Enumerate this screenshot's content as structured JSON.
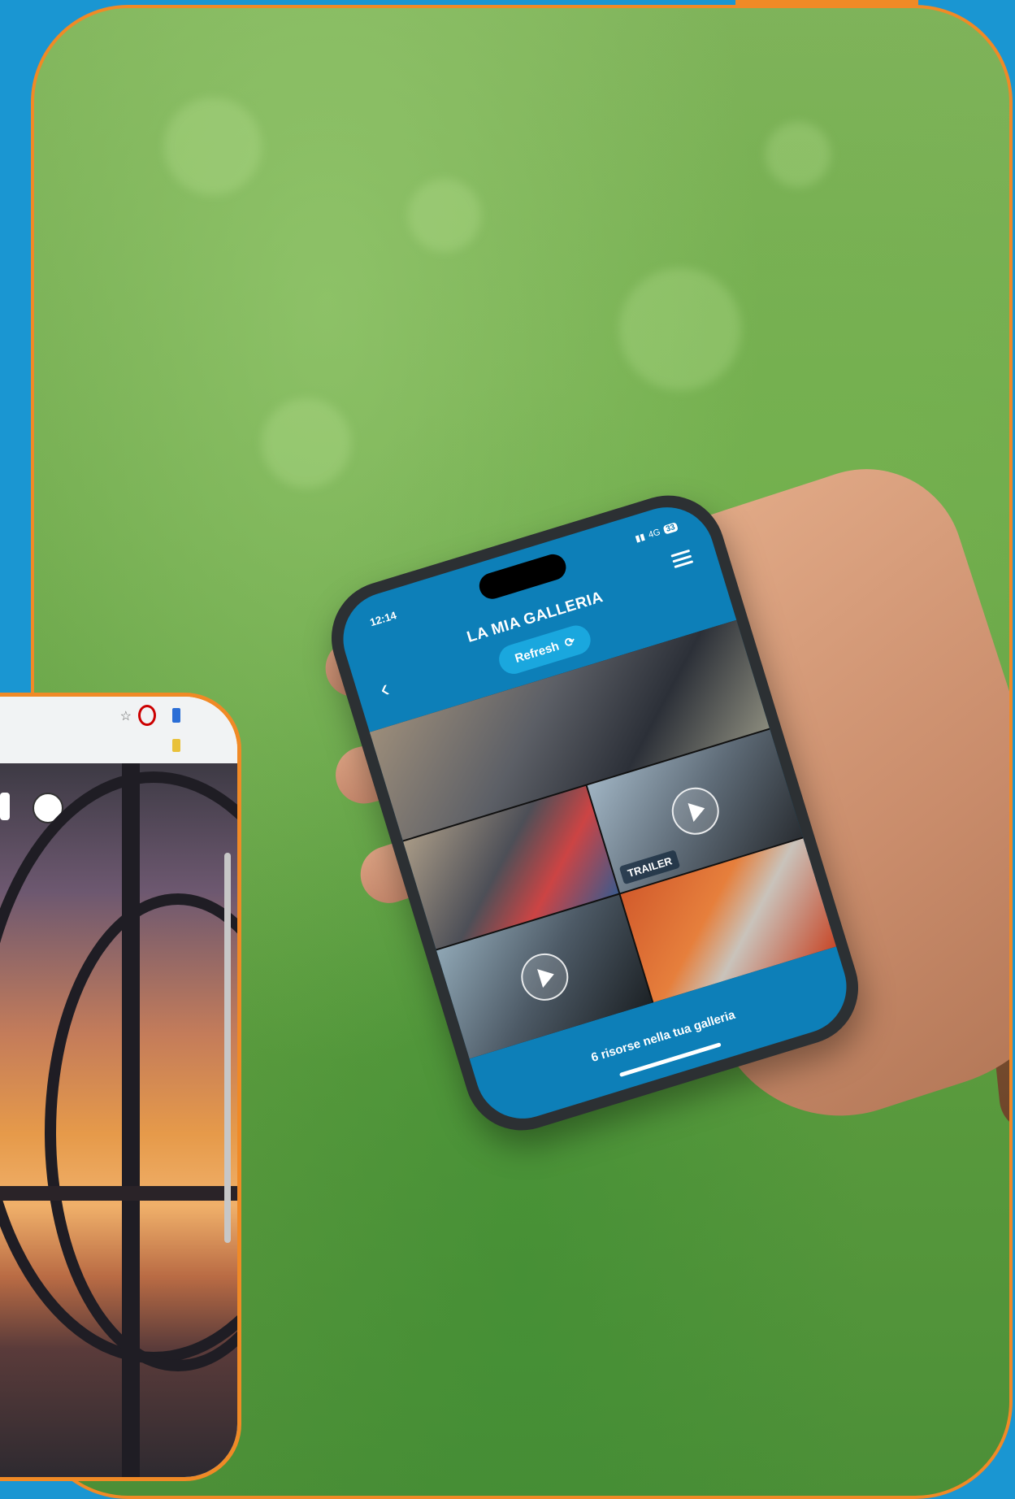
{
  "phone": {
    "status_time": "12:14",
    "status_network": "4G",
    "status_battery": "33",
    "title": "LA MIA GALLERIA",
    "refresh_label": "Refresh",
    "refresh_icon": "refresh-icon",
    "menu_icon": "hamburger-menu-icon",
    "back_icon": "chevron-left-icon",
    "trailer_label": "TRAILER",
    "footer_text": "6 risorse nella tua galleria"
  },
  "colors": {
    "brand_blue": "#1a96d2",
    "accent_orange": "#f08a26",
    "screen_blue": "#0d7fb8",
    "button_blue": "#1aa7de"
  },
  "browser": {
    "toolbar_icons": [
      "star-icon",
      "opera-icon",
      "extension-icon"
    ]
  }
}
